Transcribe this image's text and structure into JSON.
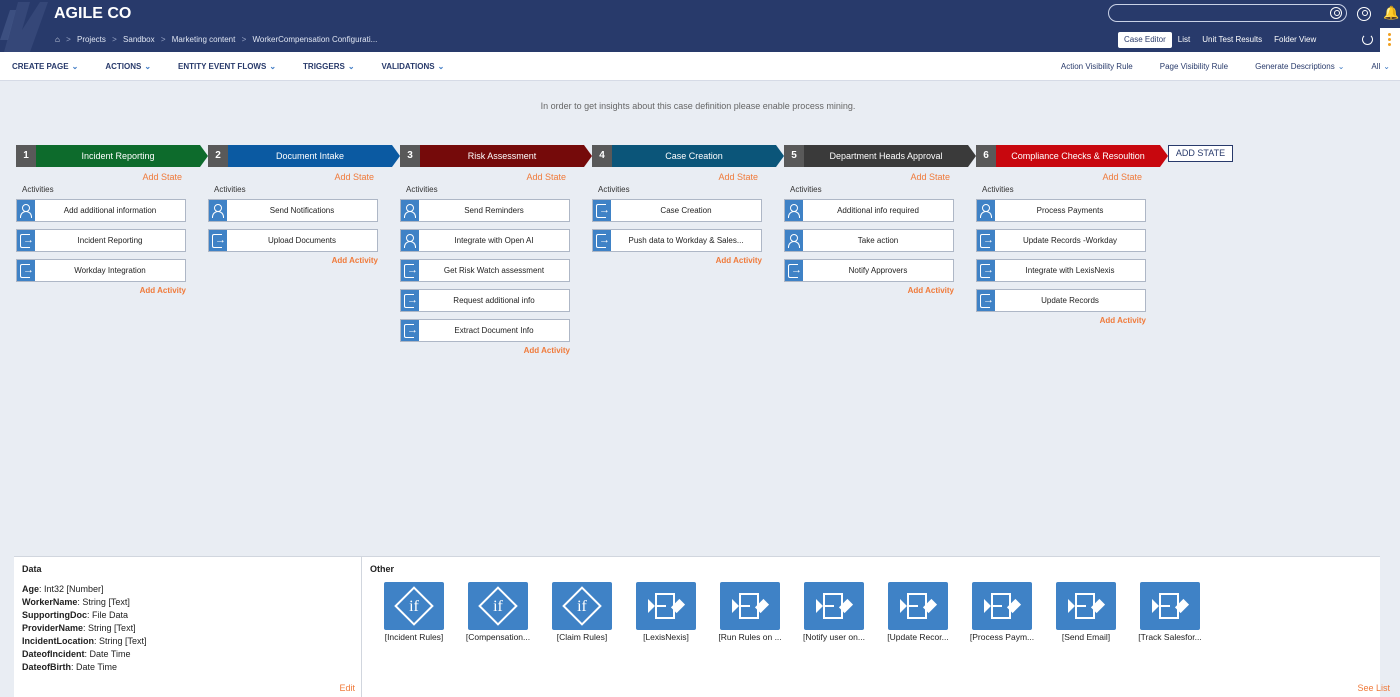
{
  "app": {
    "title": "AGILE CO"
  },
  "breadcrumb": [
    "Projects",
    "Sandbox",
    "Marketing content",
    "WorkerCompensation Configurati..."
  ],
  "mode_tabs": [
    {
      "label": "Case Editor",
      "active": true
    },
    {
      "label": "List",
      "active": false
    },
    {
      "label": "Unit Test Results",
      "active": false
    },
    {
      "label": "Folder View",
      "active": false
    }
  ],
  "menu_left": [
    "CREATE PAGE",
    "ACTIONS",
    "ENTITY EVENT FLOWS",
    "TRIGGERS",
    "VALIDATIONS"
  ],
  "menu_right": [
    "Action Visibility Rule",
    "Page Visibility Rule",
    "Generate Descriptions",
    "All"
  ],
  "insight": "In order to get insights about this case definition please enable process mining.",
  "labels": {
    "add_state": "Add State",
    "activities": "Activities",
    "add_activity": "Add Activity",
    "add_state_button": "ADD STATE"
  },
  "colors": {
    "green": "#0d6b2c",
    "blue": "#0b5aa2",
    "maroon": "#750a0a",
    "teal": "#0b5579",
    "dark": "#3a3a3a",
    "red": "#c8070e",
    "icon_blue": "#3f82c6",
    "accent_orange": "#f07a3a",
    "nav": "#283a6b"
  },
  "states": [
    {
      "num": "1",
      "name": "Incident Reporting",
      "color": "#0d6b2c",
      "activities": [
        {
          "label": "Add additional information",
          "icon": "person-icon"
        },
        {
          "label": "Incident Reporting",
          "icon": "arrow-icon"
        },
        {
          "label": "Workday Integration",
          "icon": "arrow-icon"
        }
      ]
    },
    {
      "num": "2",
      "name": "Document Intake",
      "color": "#0b5aa2",
      "activities": [
        {
          "label": "Send Notifications",
          "icon": "person-icon"
        },
        {
          "label": "Upload Documents",
          "icon": "arrow-icon"
        }
      ]
    },
    {
      "num": "3",
      "name": "Risk Assessment",
      "color": "#750a0a",
      "activities": [
        {
          "label": "Send Reminders",
          "icon": "person-icon"
        },
        {
          "label": "Integrate with Open AI",
          "icon": "person-icon"
        },
        {
          "label": "Get Risk Watch assessment",
          "icon": "arrow-icon"
        },
        {
          "label": "Request additional info",
          "icon": "arrow-icon"
        },
        {
          "label": "Extract Document Info",
          "icon": "arrow-icon"
        }
      ]
    },
    {
      "num": "4",
      "name": "Case Creation",
      "color": "#0b5579",
      "activities": [
        {
          "label": "Case Creation",
          "icon": "arrow-icon"
        },
        {
          "label": "Push data to Workday & Sales...",
          "icon": "arrow-icon"
        }
      ]
    },
    {
      "num": "5",
      "name": "Department Heads Approval",
      "color": "#3a3a3a",
      "activities": [
        {
          "label": "Additional info required",
          "icon": "person-icon"
        },
        {
          "label": "Take action",
          "icon": "person-icon"
        },
        {
          "label": "Notify Approvers",
          "icon": "arrow-icon"
        }
      ]
    },
    {
      "num": "6",
      "name": "Compliance Checks & Resoultion",
      "color": "#c8070e",
      "activities": [
        {
          "label": "Process Payments",
          "icon": "person-icon"
        },
        {
          "label": "Update Records -Workday",
          "icon": "arrow-icon"
        },
        {
          "label": "Integrate with LexisNexis",
          "icon": "arrow-icon"
        },
        {
          "label": "Update Records",
          "icon": "arrow-icon"
        }
      ]
    }
  ],
  "data_panel": {
    "title": "Data",
    "fields": [
      {
        "name": "Age",
        "type": "Int32 [Number]"
      },
      {
        "name": "WorkerName",
        "type": "String [Text]"
      },
      {
        "name": "SupportingDoc",
        "type": "File Data"
      },
      {
        "name": "ProviderName",
        "type": "String [Text]"
      },
      {
        "name": "IncidentLocation",
        "type": "String [Text]"
      },
      {
        "name": "DateofIncident",
        "type": "Date Time"
      },
      {
        "name": "DateofBirth",
        "type": "Date Time"
      }
    ],
    "edit": "Edit"
  },
  "other_panel": {
    "title": "Other",
    "items": [
      {
        "label": "[Incident Rules]",
        "kind": "if"
      },
      {
        "label": "[Compensation...",
        "kind": "if"
      },
      {
        "label": "[Claim Rules]",
        "kind": "if"
      },
      {
        "label": "[LexisNexis]",
        "kind": "flow"
      },
      {
        "label": "[Run Rules on ...",
        "kind": "flow"
      },
      {
        "label": "[Notify user on...",
        "kind": "flow"
      },
      {
        "label": "[Update Recor...",
        "kind": "flow"
      },
      {
        "label": "[Process Paym...",
        "kind": "flow"
      },
      {
        "label": "[Send Email]",
        "kind": "flow"
      },
      {
        "label": "[Track Salesfor...",
        "kind": "flow"
      }
    ],
    "see_list": "See List"
  }
}
